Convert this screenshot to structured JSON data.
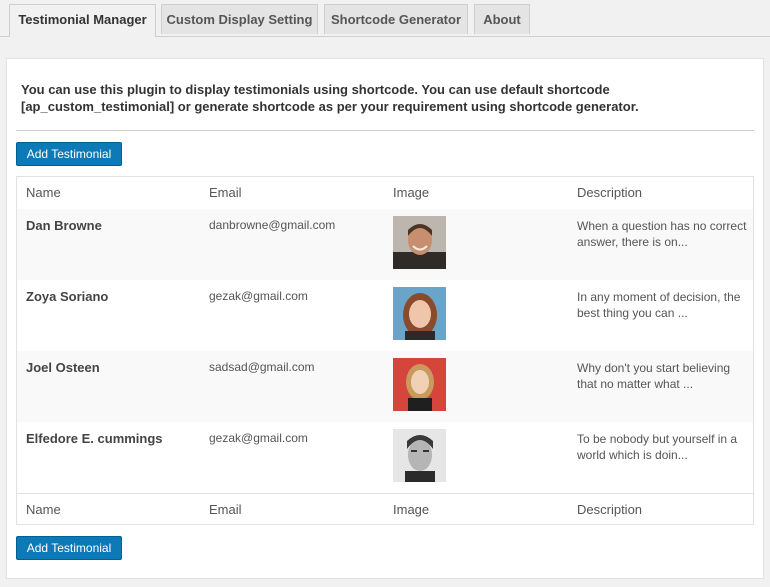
{
  "tabs": [
    {
      "label": "Testimonial Manager",
      "active": true
    },
    {
      "label": "Custom Display Setting",
      "active": false
    },
    {
      "label": "Shortcode Generator",
      "active": false
    },
    {
      "label": "About",
      "active": false
    }
  ],
  "intro": {
    "text": "You can use this plugin to display testimonials using shortcode. You can use default shortcode  [ap_custom_testimonial] or generate shortcode as per your requirement using shortcode generator."
  },
  "buttons": {
    "add_top": "Add Testimonial",
    "add_bottom": "Add Testimonial"
  },
  "table": {
    "columns": [
      "Name",
      "Email",
      "Image",
      "Description"
    ],
    "rows": [
      {
        "name": "Dan Browne",
        "email": "danbrowne@gmail.com",
        "image": "photo-man-smiling",
        "description": "When a question has no correct answer, there is on..."
      },
      {
        "name": "Zoya Soriano",
        "email": "gezak@gmail.com",
        "image": "photo-woman-auburn-hair",
        "description": "In any moment of decision, the best thing you can ..."
      },
      {
        "name": "Joel Osteen",
        "email": "sadsad@gmail.com",
        "image": "photo-woman-red-background",
        "description": "Why don't you start believing that no matter what ..."
      },
      {
        "name": "Elfedore E. cummings",
        "email": "gezak@gmail.com",
        "image": "photo-man-black-white",
        "description": "To be nobody but yourself in a world which is doin..."
      }
    ]
  },
  "colors": {
    "button_bg": "#0b7ab6",
    "stripe_bg": "#f9f9f9"
  }
}
